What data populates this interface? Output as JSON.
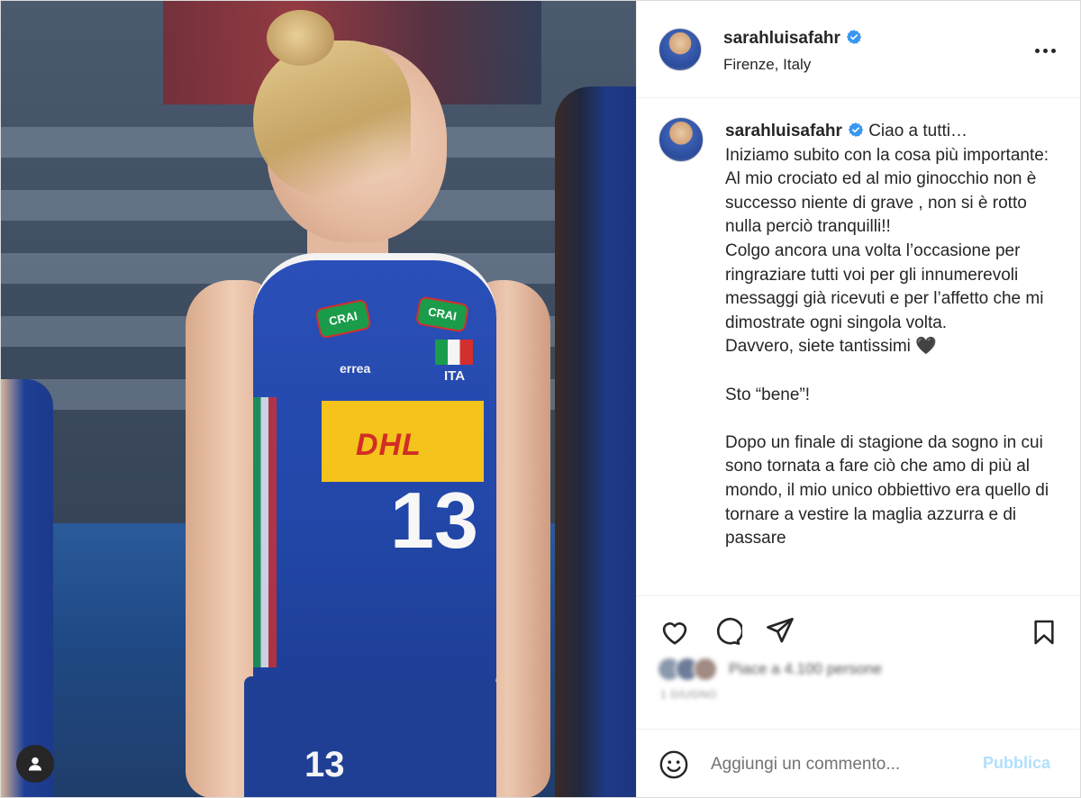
{
  "header": {
    "username": "sarahluisafahr",
    "location": "Firenze, Italy"
  },
  "caption": {
    "username": "sarahluisafahr",
    "text": "Ciao a tutti…\nIniziamo subito con la cosa più importante:\nAl mio crociato ed al mio ginocchio non è successo niente di grave , non si è rotto nulla perciò tranquilli!!\nColgo ancora una volta l’occasione per ringraziare tutti voi per gli innumerevoli messaggi già ricevuti e per l’affetto che mi dimostrate ogni singola volta.\nDavvero, siete tantissimi 🖤\n\nSto “bene”!\n\nDopo un finale di stagione da sogno in cui sono tornata a fare ciò che amo di più al mondo, il mio unico obbiettivo era quello di tornare a vestire la maglia azzurra e di passare"
  },
  "photo": {
    "jersey_number": "13",
    "shorts_number": "13",
    "sponsor": "DHL",
    "brand_left": "CRAI",
    "brand_right": "CRAI",
    "country": "ITA",
    "maker": "errea"
  },
  "likes": {
    "text": "Piace a 4.100 persone",
    "date": "1 GIUGNO"
  },
  "comment": {
    "placeholder": "Aggiungi un commento...",
    "publish_label": "Pubblica"
  },
  "icons": [
    "verified-badge-icon",
    "more-options-icon",
    "heart-icon",
    "comment-icon",
    "share-icon",
    "bookmark-icon",
    "emoji-icon",
    "user-tag-icon"
  ],
  "colors": {
    "verified_blue": "#3897f0",
    "publish_disabled": "#b2dffc",
    "text": "#262626"
  }
}
